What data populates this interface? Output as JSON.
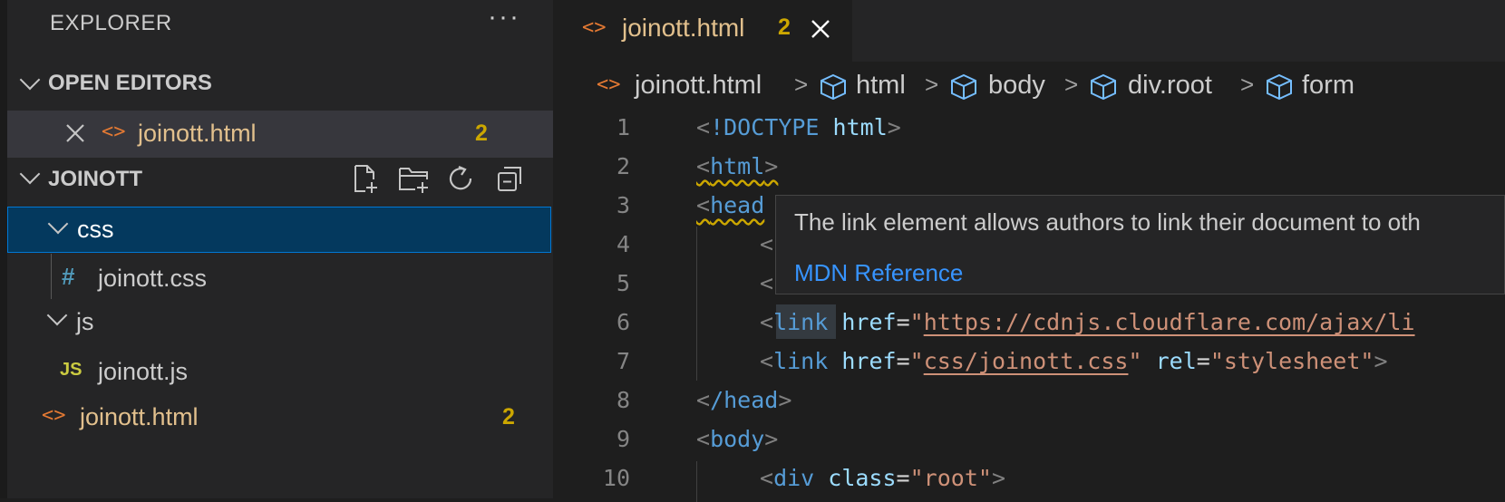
{
  "sidebar": {
    "title": "EXPLORER",
    "more_actions": "···",
    "open_editors": {
      "title": "OPEN EDITORS",
      "items": [
        {
          "name": "joinott.html",
          "badge": "2"
        }
      ]
    },
    "project": {
      "title": "JOINOTT",
      "tree": [
        {
          "name": "css",
          "type": "folder"
        },
        {
          "name": "joinott.css",
          "type": "file",
          "icon": "#"
        },
        {
          "name": "js",
          "type": "folder"
        },
        {
          "name": "joinott.js",
          "type": "file",
          "icon": "JS"
        },
        {
          "name": "joinott.html",
          "type": "file",
          "badge": "2"
        }
      ]
    }
  },
  "tab": {
    "label": "joinott.html",
    "badge": "2"
  },
  "breadcrumb": [
    "joinott.html",
    "html",
    "body",
    "div.root",
    "form"
  ],
  "code": {
    "line_numbers": [
      "1",
      "2",
      "3",
      "4",
      "5",
      "6",
      "7",
      "8",
      "9",
      "10"
    ],
    "l1_doctype": "!DOCTYPE",
    "l1_html": "html",
    "l2_tag": "html",
    "l3_tag": "head",
    "l6_tag": "link",
    "l6_attr": "href",
    "l6_val": "https://cdnjs.cloudflare.com/ajax/li",
    "l7_tag": "link",
    "l7_attr1": "href",
    "l7_val1": "css/joinott.css",
    "l7_attr2": "rel",
    "l7_val2": "stylesheet",
    "l8_tag": "/head",
    "l9_tag": "body",
    "l10_tag": "div",
    "l10_attr": "class",
    "l10_val": "root"
  },
  "hover": {
    "text": "The link element allows authors to link their document to oth",
    "link": "MDN Reference"
  },
  "colors": {
    "accent": "#0078d4",
    "selection": "#04395e",
    "modified": "#e2c08d",
    "warning": "#cca700",
    "link": "#3794ff"
  }
}
